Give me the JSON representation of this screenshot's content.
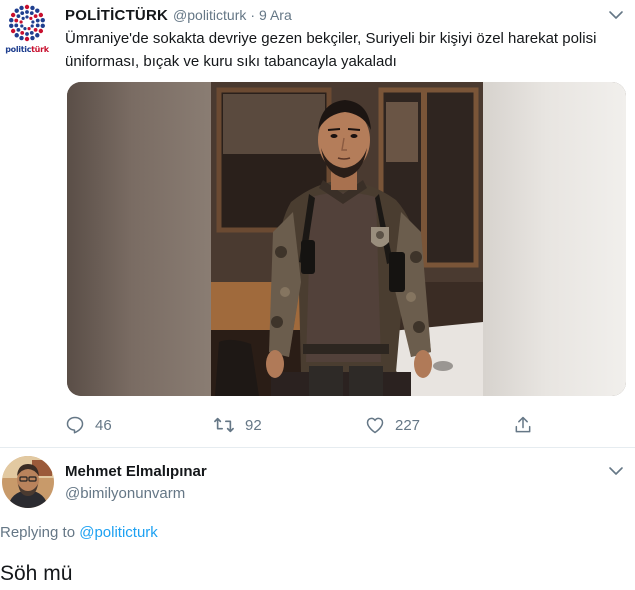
{
  "tweet": {
    "account": {
      "display_name": "POLİTİCTÜRK",
      "handle": "@politicturk",
      "separator": "·",
      "date": "9 Ara",
      "logo_text_a": "politic",
      "logo_text_b": "türk"
    },
    "text": "Ümraniye'de sokakta devriye gezen bekçiler, Suriyeli bir kişiyi özel harekat polisi üniforması, bıçak ve kuru sıkı tabancayla yakaladı",
    "actions": {
      "replies": "46",
      "retweets": "92",
      "likes": "227"
    },
    "icons": {
      "more": "chevron-down-icon",
      "reply": "comment-icon",
      "retweet": "retweet-icon",
      "like": "heart-icon",
      "share": "share-icon"
    }
  },
  "reply": {
    "display_name": "Mehmet Elmalıpınar",
    "handle": "@bimilyonunvarm",
    "replying_prefix": "Replying to ",
    "replying_to": "@politicturk",
    "text": "Söh mü"
  },
  "colors": {
    "text_primary": "#14171a",
    "text_secondary": "#657786",
    "link": "#1da1f2",
    "divider": "#e6ecf0",
    "logo_blue": "#1f3f8f",
    "logo_red": "#c8102e"
  }
}
